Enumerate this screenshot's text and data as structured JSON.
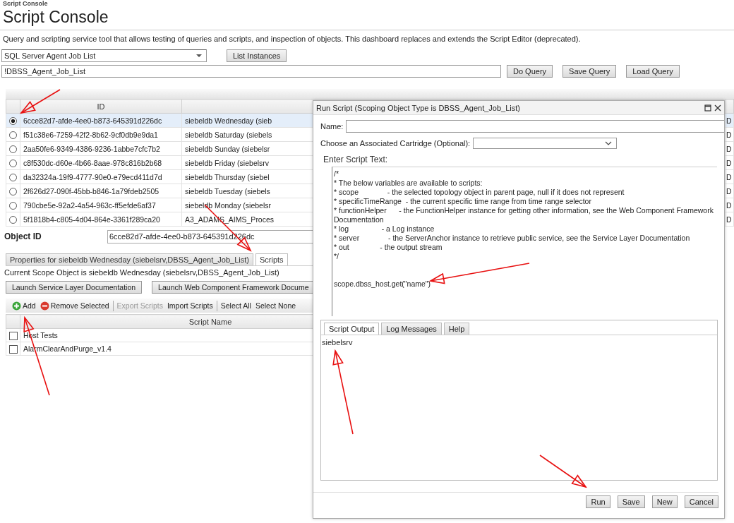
{
  "page": {
    "breadcrumb": "Script Console",
    "title": "Script Console",
    "description": "Query and scripting service tool that allows testing of queries and scripts, and inspection of objects. This dashboard replaces and extends the Script Editor (deprecated)."
  },
  "query": {
    "type_select": "SQL Server Agent Job List",
    "list_button": "List Instances",
    "query_text": "!DBSS_Agent_Job_List",
    "buttons": [
      "Do Query",
      "Save Query",
      "Load Query"
    ]
  },
  "instances": {
    "columns": [
      "ID"
    ],
    "rows": [
      {
        "id": "6cce82d7-afde-4ee0-b873-645391d226dc",
        "column_2": "siebeldb Wednesday (sieb",
        "column_3": "D",
        "selected": true
      },
      {
        "id": "f51c38e6-7259-42f2-8b62-9cf0db9e9da1",
        "column_2": "siebeldb Saturday (siebels",
        "column_3": "D",
        "selected": false
      },
      {
        "id": "2aa50fe6-9349-4386-9236-1abbe7cfc7b2",
        "column_2": "siebeldb Sunday (siebelsr",
        "column_3": "D",
        "selected": false
      },
      {
        "id": "c8f530dc-d60e-4b66-8aae-978c816b2b68",
        "column_2": "siebeldb Friday (siebelsrv",
        "column_3": "D",
        "selected": false
      },
      {
        "id": "da32324a-19f9-4777-90e0-e79ecd411d7d",
        "column_2": "siebeldb Thursday (siebel",
        "column_3": "D",
        "selected": false
      },
      {
        "id": "2f626d27-090f-45bb-b846-1a79fdeb2505",
        "column_2": "siebeldb Tuesday (siebels",
        "column_3": "D",
        "selected": false
      },
      {
        "id": "790cbe5e-92a2-4a54-963c-ff5efde6af37",
        "column_2": "siebeldb Monday (siebelsr",
        "column_3": "D",
        "selected": false
      },
      {
        "id": "5f1818b4-c805-4d04-864e-3361f289ca20",
        "column_2": "A3_ADAMS_AIMS_Proces",
        "column_3": "D",
        "selected": false
      }
    ]
  },
  "object_id": {
    "label": "Object ID",
    "value": "6cce82d7-afde-4ee0-b873-645391d226dc"
  },
  "tabs": [
    {
      "label": "Properties for siebeldb Wednesday (siebelsrv,DBSS_Agent_Job_List)",
      "selected": false
    },
    {
      "label": "Scripts",
      "selected": true
    }
  ],
  "scope_text": "Current Scope Object is siebeldb Wednesday (siebelsrv,DBSS_Agent_Job_List)",
  "doc_buttons": [
    "Launch Service Layer Documentation",
    "Launch Web Component Framework Docume"
  ],
  "toolbar": [
    {
      "label": "Add",
      "kind": "add",
      "disabled": false
    },
    {
      "label": "Remove Selected",
      "kind": "remove",
      "disabled": false
    },
    {
      "kind": "separator"
    },
    {
      "label": "Export Scripts",
      "kind": "plain",
      "disabled": true
    },
    {
      "label": "Import Scripts",
      "kind": "plain",
      "disabled": false
    },
    {
      "kind": "separator"
    },
    {
      "label": "Select All",
      "kind": "plain",
      "disabled": false
    },
    {
      "label": "Select None",
      "kind": "plain",
      "disabled": false
    }
  ],
  "scripts": {
    "column": "Script Name",
    "rows": [
      {
        "name": "Host Tests",
        "checked": false
      },
      {
        "name": "AlarmClearAndPurge_v1.4",
        "checked": false
      }
    ]
  },
  "dialog": {
    "title": "Run Script (Scoping Object Type is DBSS_Agent_Job_List)",
    "name_label": "Name:",
    "cartridge_label": "Choose an Associated Cartridge (Optional):",
    "script_label": "Enter Script Text:",
    "script_text": "/*\n* The below variables are available to scripts:\n* scope              - the selected topology object in parent page, null if it does not represent\n* specificTimeRange  - the current specific time range from time range selector\n* functionHelper      - the FunctionHelper instance for getting other information, see the Web Component Framework Documentation\n* log                - a Log instance\n* server              - the ServerAnchor instance to retrieve public service, see the Service Layer Documentation\n* out               - the output stream\n*/\n\n\nscope.dbss_host.get(\"name\")",
    "output_tabs": [
      {
        "label": "Script Output",
        "selected": true
      },
      {
        "label": "Log Messages",
        "selected": false
      },
      {
        "label": "Help",
        "selected": false
      }
    ],
    "output": "siebelsrv",
    "buttons": [
      "Run",
      "Save",
      "New",
      "Cancel"
    ]
  }
}
